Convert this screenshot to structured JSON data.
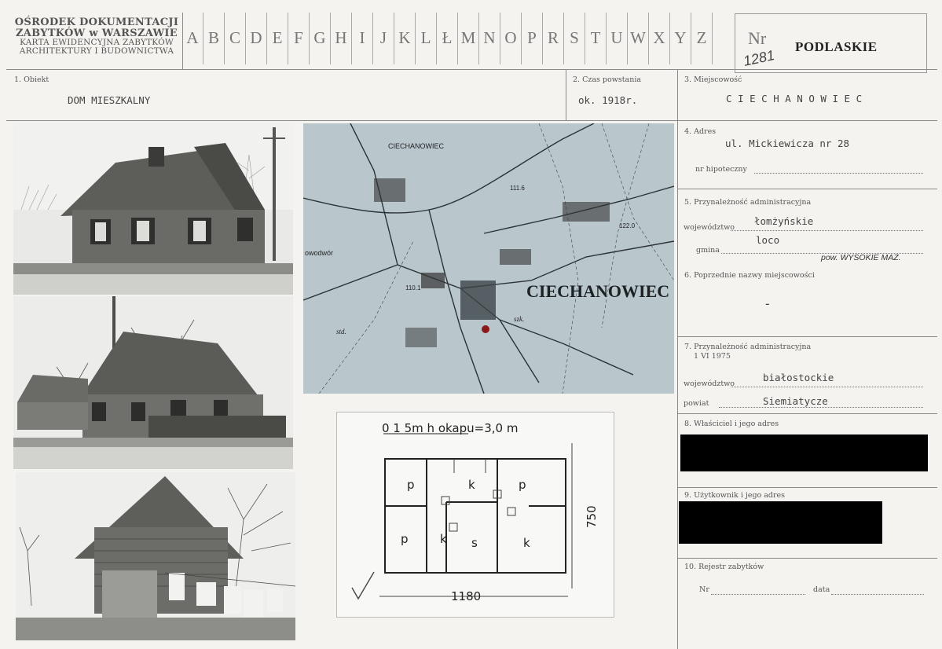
{
  "header": {
    "org_line1": "OŚRODEK DOKUMENTACJI",
    "org_line2": "ZABYTKÓW w WARSZAWIE",
    "org_line3": "KARTA EWIDENCYJNA ZABYTKÓW",
    "org_line4": "ARCHITEKTURY I BUDOWNICTWA",
    "letters": [
      "A",
      "B",
      "C",
      "D",
      "E",
      "F",
      "G",
      "H",
      "I",
      "J",
      "K",
      "L",
      "Ł",
      "M",
      "N",
      "O",
      "P",
      "R",
      "S",
      "T",
      "U",
      "W",
      "X",
      "Y",
      "Z"
    ],
    "nr_label": "Nr",
    "nr_value": "1281",
    "region": "PODLASKIE"
  },
  "fields": {
    "f1_label": "1. Obiekt",
    "f1_value": "DOM MIESZKALNY",
    "f2_label": "2. Czas powstania",
    "f2_value": "ok. 1918r.",
    "f3_label": "3. Miejscowość",
    "f3_value": "C I E C H A N O W I E C",
    "f4_label": "4. Adres",
    "f4_value": "ul. Mickiewicza nr 28",
    "f4_sub": "nr hipoteczny",
    "f5_label": "5. Przynależność administracyjna",
    "f5_woj_label": "województwo",
    "f5_woj_value": "łomżyńskie",
    "f5_gmina_label": "gmina",
    "f5_gmina_value": "loco",
    "f5_note": "pow. WYSOKIE MAZ.",
    "f6_label": "6. Poprzednie nazwy miejscowości",
    "f6_value": "-",
    "f7_label": "7. Przynależność administracyjna",
    "f7_date": "1 VI 1975",
    "f7_woj_label": "województwo",
    "f7_woj_value": "białostockie",
    "f7_pow_label": "powiat",
    "f7_pow_value": "Siemiatycze",
    "f8_label": "8. Właściciel i jego adres",
    "f9_label": "9. Użytkownik i jego adres",
    "f10_label": "10. Rejestr zabytków",
    "f10_nr": "Nr",
    "f10_data": "data"
  },
  "map": {
    "town_label": "CIECHANOWIEC",
    "small_town_label": "CIECHANOWIEC",
    "elev1": "111.6",
    "elev2": "122.0",
    "elev3": "110.1",
    "place1": "owodwór",
    "place2": "szk.",
    "place3": "std."
  },
  "plan": {
    "scale_text": "0 1        5m  h okapu=3,0 m",
    "room_p": "p",
    "room_k": "k",
    "room_s": "s",
    "width": "1180",
    "depth": "750"
  },
  "colors": {
    "paper": "#f4f3ef",
    "map": "#b9c6cc",
    "ink": "#333333"
  }
}
